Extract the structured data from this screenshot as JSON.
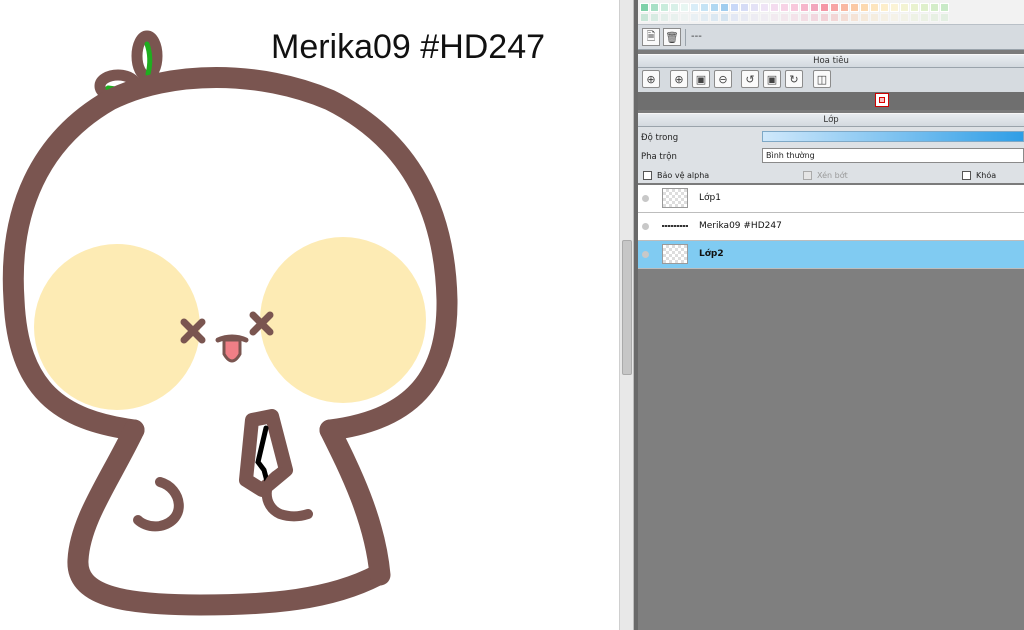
{
  "canvas": {
    "title": "Merika09 #HD247"
  },
  "swatches": {
    "row1": [
      "#7fd1a9",
      "#a8e0c6",
      "#c9ecdc",
      "#d8f0e8",
      "#e7f6f2",
      "#d9edf8",
      "#c5e3f5",
      "#b1d8f2",
      "#a0cdef",
      "#c8d8f8",
      "#d6dcf6",
      "#e4e2f6",
      "#efe4f6",
      "#f4dcef",
      "#f7d3e6",
      "#f8c8dc",
      "#f6b7cc",
      "#f2a7bd",
      "#f597a6",
      "#f7a4a4",
      "#f9b8a2",
      "#fbc9a5",
      "#fcd9b0",
      "#fde5be",
      "#fdeecb",
      "#fbf3d6",
      "#f3f3d3",
      "#e9f2cf",
      "#dff0cc",
      "#d4edc9",
      "#c9eac7"
    ]
  },
  "file_bar": {
    "new_icon": "new-file-icon",
    "delete_icon": "trash-icon",
    "dash": "---"
  },
  "navigator": {
    "header": "Hoa tiêu",
    "tools": [
      "zoom-fit-icon",
      "zoom-in-icon",
      "fit-window-icon",
      "zoom-out-icon",
      "rotate-left-icon",
      "reset-rotation-icon",
      "rotate-right-icon",
      "flip-icon"
    ]
  },
  "layers": {
    "header": "Lớp",
    "opacity_label": "Độ trong",
    "blend_label": "Pha trộn",
    "blend_value": "Bình thường",
    "protect_alpha_label": "Bảo vệ alpha",
    "clipping_label": "Xén bớt",
    "lock_label": "Khóa",
    "items": [
      {
        "name": "Lớp1",
        "kind": "image",
        "selected": false
      },
      {
        "name": "Merika09 #HD247",
        "kind": "text",
        "selected": false
      },
      {
        "name": "Lớp2",
        "kind": "image",
        "selected": true
      }
    ]
  }
}
